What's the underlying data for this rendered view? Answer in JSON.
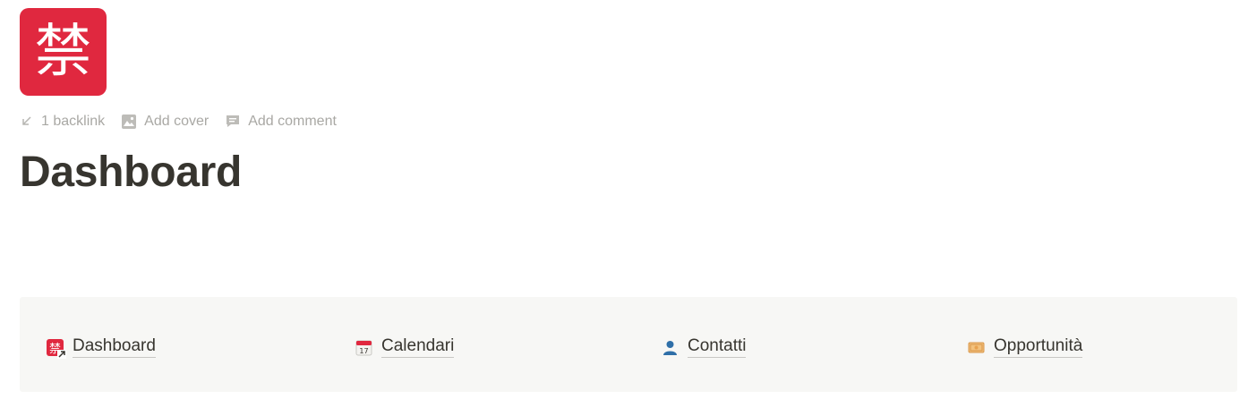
{
  "page": {
    "icon_glyph": "禁",
    "icon_name": "prohibited-kanji-icon",
    "title": "Dashboard"
  },
  "meta": {
    "backlink_label": "1 backlink",
    "add_cover_label": "Add cover",
    "add_comment_label": "Add comment"
  },
  "nav": {
    "links": [
      {
        "label": "Dashboard",
        "icon": "prohibited-kanji-icon"
      },
      {
        "label": "Calendari",
        "icon": "calendar-icon"
      },
      {
        "label": "Contatti",
        "icon": "person-icon"
      },
      {
        "label": "Opportunità",
        "icon": "money-icon"
      }
    ]
  },
  "colors": {
    "accent_red": "#e0283f",
    "text": "#37352f",
    "muted": "#a9a8a4",
    "callout_bg": "#f7f7f5"
  }
}
